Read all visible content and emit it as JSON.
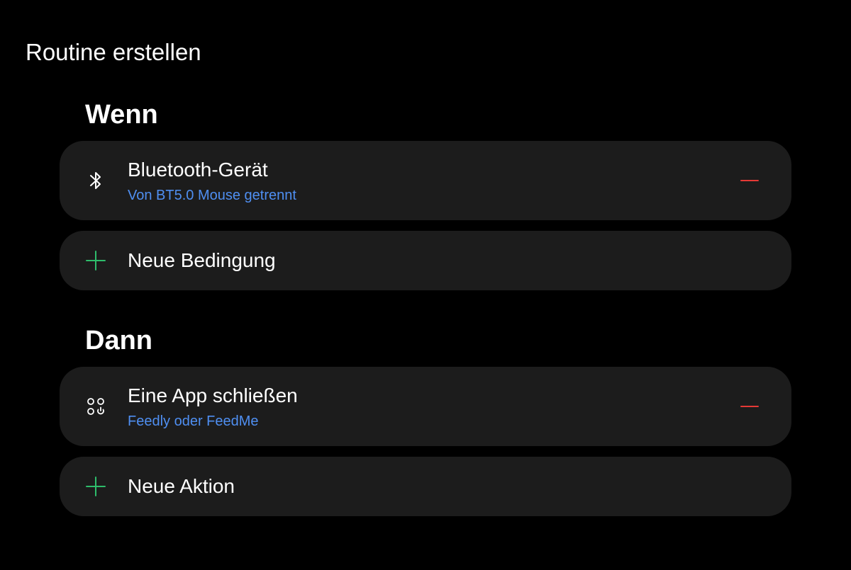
{
  "header": {
    "title": "Routine erstellen"
  },
  "if_section": {
    "heading": "Wenn",
    "conditions": [
      {
        "icon": "bluetooth-icon",
        "title": "Bluetooth-Gerät",
        "subtitle": "Von BT5.0 Mouse getrennt",
        "remove_icon": "minus-icon"
      }
    ],
    "add_label": "Neue Bedingung",
    "add_icon": "plus-icon"
  },
  "then_section": {
    "heading": "Dann",
    "actions": [
      {
        "icon": "apps-icon",
        "title": "Eine App schließen",
        "subtitle": "Feedly oder FeedMe",
        "remove_icon": "minus-icon"
      }
    ],
    "add_label": "Neue Aktion",
    "add_icon": "plus-icon"
  },
  "colors": {
    "background": "#000000",
    "card": "#1c1c1c",
    "subtitle_accent": "#4f8ff2",
    "add_accent": "#2ebd6b",
    "remove_accent": "#e53935"
  }
}
